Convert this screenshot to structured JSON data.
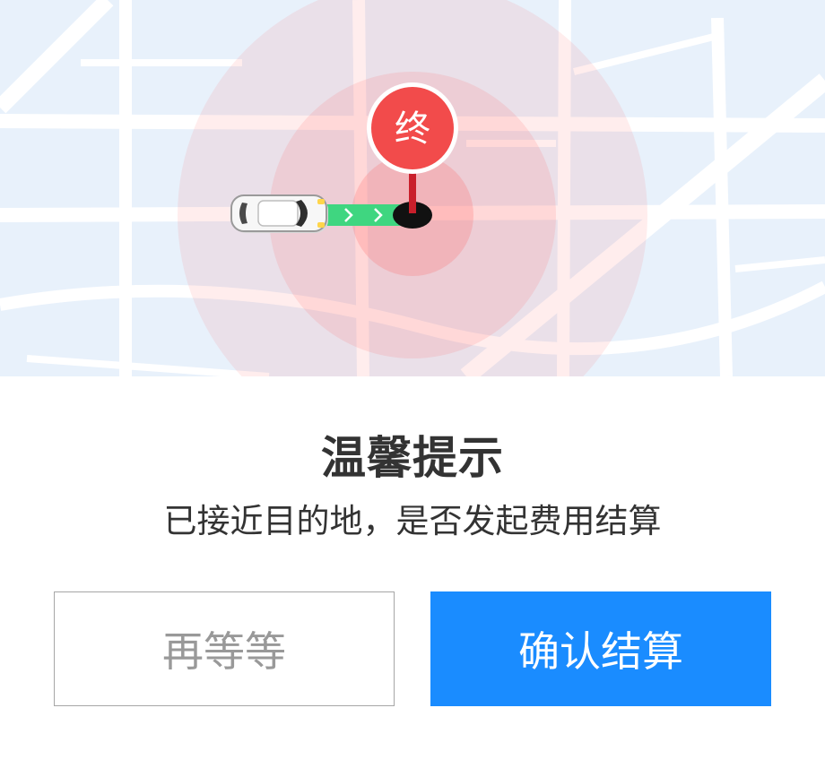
{
  "map": {
    "destination_marker_label": "终",
    "colors": {
      "map_background": "#e8f1fb",
      "road": "#ffffff",
      "radar": "#ff5b5b",
      "marker": "#f24b4b",
      "route": "#3fd680"
    },
    "icons": [
      "car-icon",
      "destination-pin-icon",
      "route-arrow-icon"
    ]
  },
  "dialog": {
    "title": "温馨提示",
    "message": "已接近目的地，是否发起费用结算",
    "buttons": {
      "wait_label": "再等等",
      "confirm_label": "确认结算"
    }
  },
  "colors": {
    "primary": "#1a8cff",
    "text": "#333333",
    "secondary_text": "#999999"
  }
}
